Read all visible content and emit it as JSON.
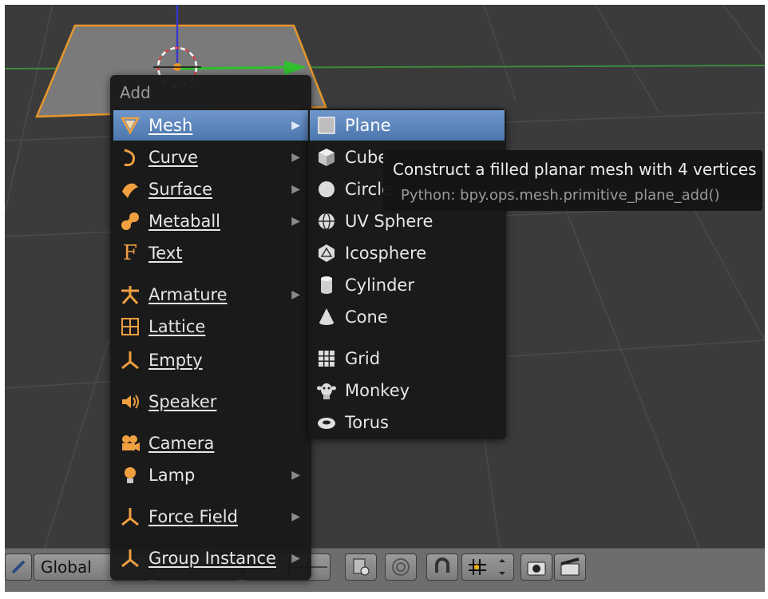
{
  "add_menu": {
    "title": "Add",
    "items": [
      {
        "label": "Mesh",
        "icon": "mesh-icon",
        "submenu": true
      },
      {
        "label": "Curve",
        "icon": "curve-icon",
        "submenu": true
      },
      {
        "label": "Surface",
        "icon": "surface-icon",
        "submenu": true
      },
      {
        "label": "Metaball",
        "icon": "metaball-icon",
        "submenu": true
      },
      {
        "label": "Text",
        "icon": "text-icon",
        "submenu": false
      },
      {
        "label": "Armature",
        "icon": "armature-icon",
        "submenu": true
      },
      {
        "label": "Lattice",
        "icon": "lattice-icon",
        "submenu": false
      },
      {
        "label": "Empty",
        "icon": "empty-icon",
        "submenu": true
      },
      {
        "label": "Speaker",
        "icon": "speaker-icon",
        "submenu": false
      },
      {
        "label": "Camera",
        "icon": "camera-icon",
        "submenu": false
      },
      {
        "label": "Lamp",
        "icon": "lamp-icon",
        "submenu": true
      },
      {
        "label": "Force Field",
        "icon": "force-field-icon",
        "submenu": true
      },
      {
        "label": "Group Instance",
        "icon": "group-instance-icon",
        "submenu": true
      }
    ],
    "arrow": "▶"
  },
  "mesh_menu": {
    "items": [
      {
        "label": "Plane",
        "icon": "plane-icon"
      },
      {
        "label": "Cube",
        "icon": "cube-icon"
      },
      {
        "label": "Circle",
        "icon": "circle-icon"
      },
      {
        "label": "UV Sphere",
        "icon": "uv-sphere-icon"
      },
      {
        "label": "Icosphere",
        "icon": "icosphere-icon"
      },
      {
        "label": "Cylinder",
        "icon": "cylinder-icon"
      },
      {
        "label": "Cone",
        "icon": "cone-icon"
      },
      {
        "label": "Grid",
        "icon": "grid-icon"
      },
      {
        "label": "Monkey",
        "icon": "monkey-icon"
      },
      {
        "label": "Torus",
        "icon": "torus-icon"
      }
    ]
  },
  "tooltip": {
    "description": "Construct a filled planar mesh with 4 vertices",
    "python": "Python: bpy.ops.mesh.primitive_plane_add()"
  },
  "bottom_bar": {
    "orientation": "Global"
  },
  "colors": {
    "highlight": "#5a84bb",
    "selection_outline": "#e8962c",
    "axis_green": "#2fbf2f",
    "viewport_bg": "#3b3b3b"
  }
}
